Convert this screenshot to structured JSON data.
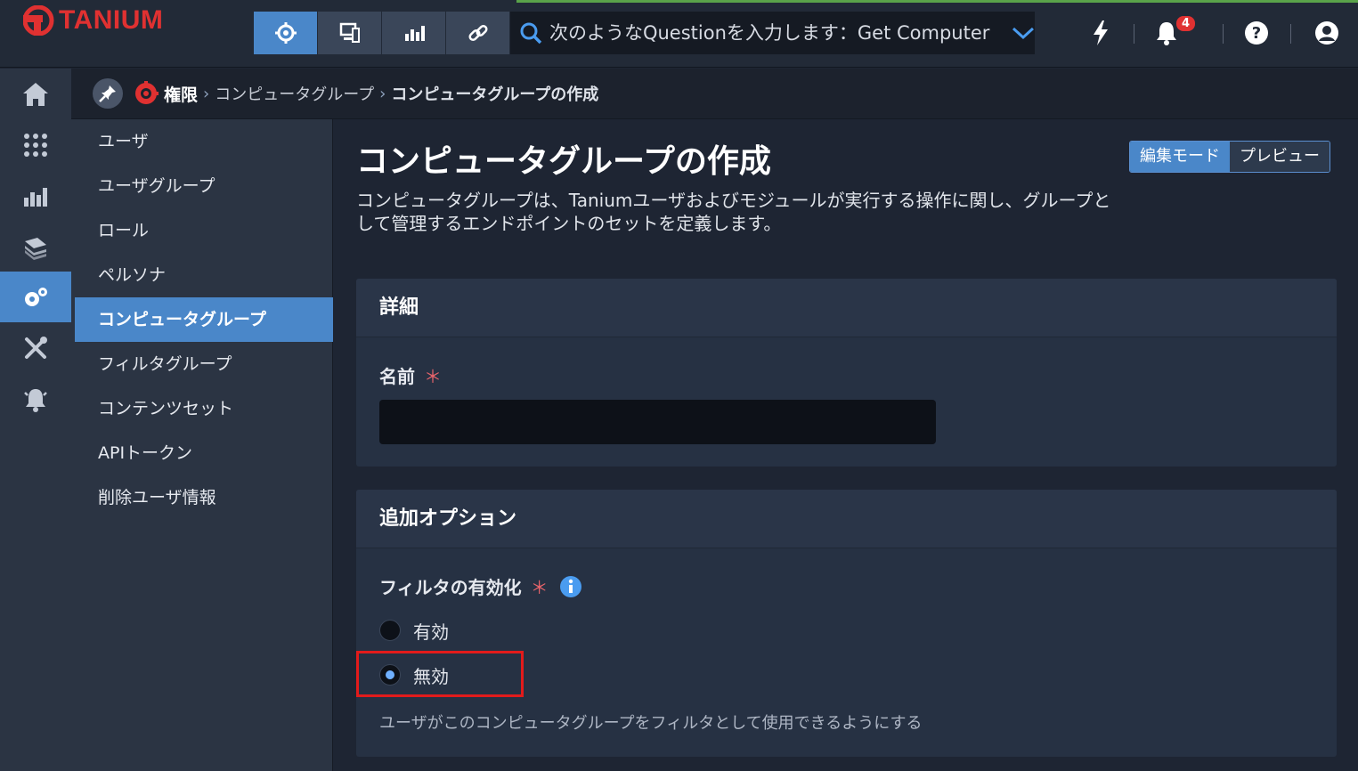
{
  "app": {
    "brand": "TANIUM",
    "brand_color": "#e03131",
    "accent_color": "#4a87c9"
  },
  "topbar": {
    "nav_buttons": [
      {
        "icon": "target-icon",
        "active": true
      },
      {
        "icon": "monitor-icon",
        "active": false
      },
      {
        "icon": "bar-chart-icon",
        "active": false
      },
      {
        "icon": "link-icon",
        "active": false
      }
    ],
    "search_placeholder": "次のようなQuestionを入力します：Get Computer",
    "notifications_count": "4"
  },
  "rail": {
    "items": [
      "home-icon",
      "apps-grid-icon",
      "reports-icon",
      "layers-icon",
      "settings-gears-icon",
      "tools-icon",
      "alarm-bell-icon"
    ],
    "active_index": 4
  },
  "breadcrumb": {
    "root": "権限",
    "items": [
      "コンピュータグループ",
      "コンピュータグループの作成"
    ]
  },
  "subnav": {
    "items": [
      "ユーザ",
      "ユーザグループ",
      "ロール",
      "ペルソナ",
      "コンピュータグループ",
      "フィルタグループ",
      "コンテンツセット",
      "APIトークン",
      "削除ユーザ情報"
    ],
    "active_index": 4
  },
  "main": {
    "title": "コンピュータグループの作成",
    "description": "コンピュータグループは、Taniumユーザおよびモジュールが実行する操作に関し、グループとして管理するエンドポイントのセットを定義します。",
    "modes": {
      "edit": "編集モード",
      "preview": "プレビュー"
    },
    "details": {
      "heading": "詳細",
      "name_label": "名前",
      "required_mark": "＊",
      "name_value": ""
    },
    "options": {
      "heading": "追加オプション",
      "filter_label": "フィルタの有効化",
      "required_mark": "＊",
      "enabled_label": "有効",
      "disabled_label": "無効",
      "selected": "無効",
      "help": "ユーザがこのコンピュータグループをフィルタとして使用できるようにする"
    }
  }
}
